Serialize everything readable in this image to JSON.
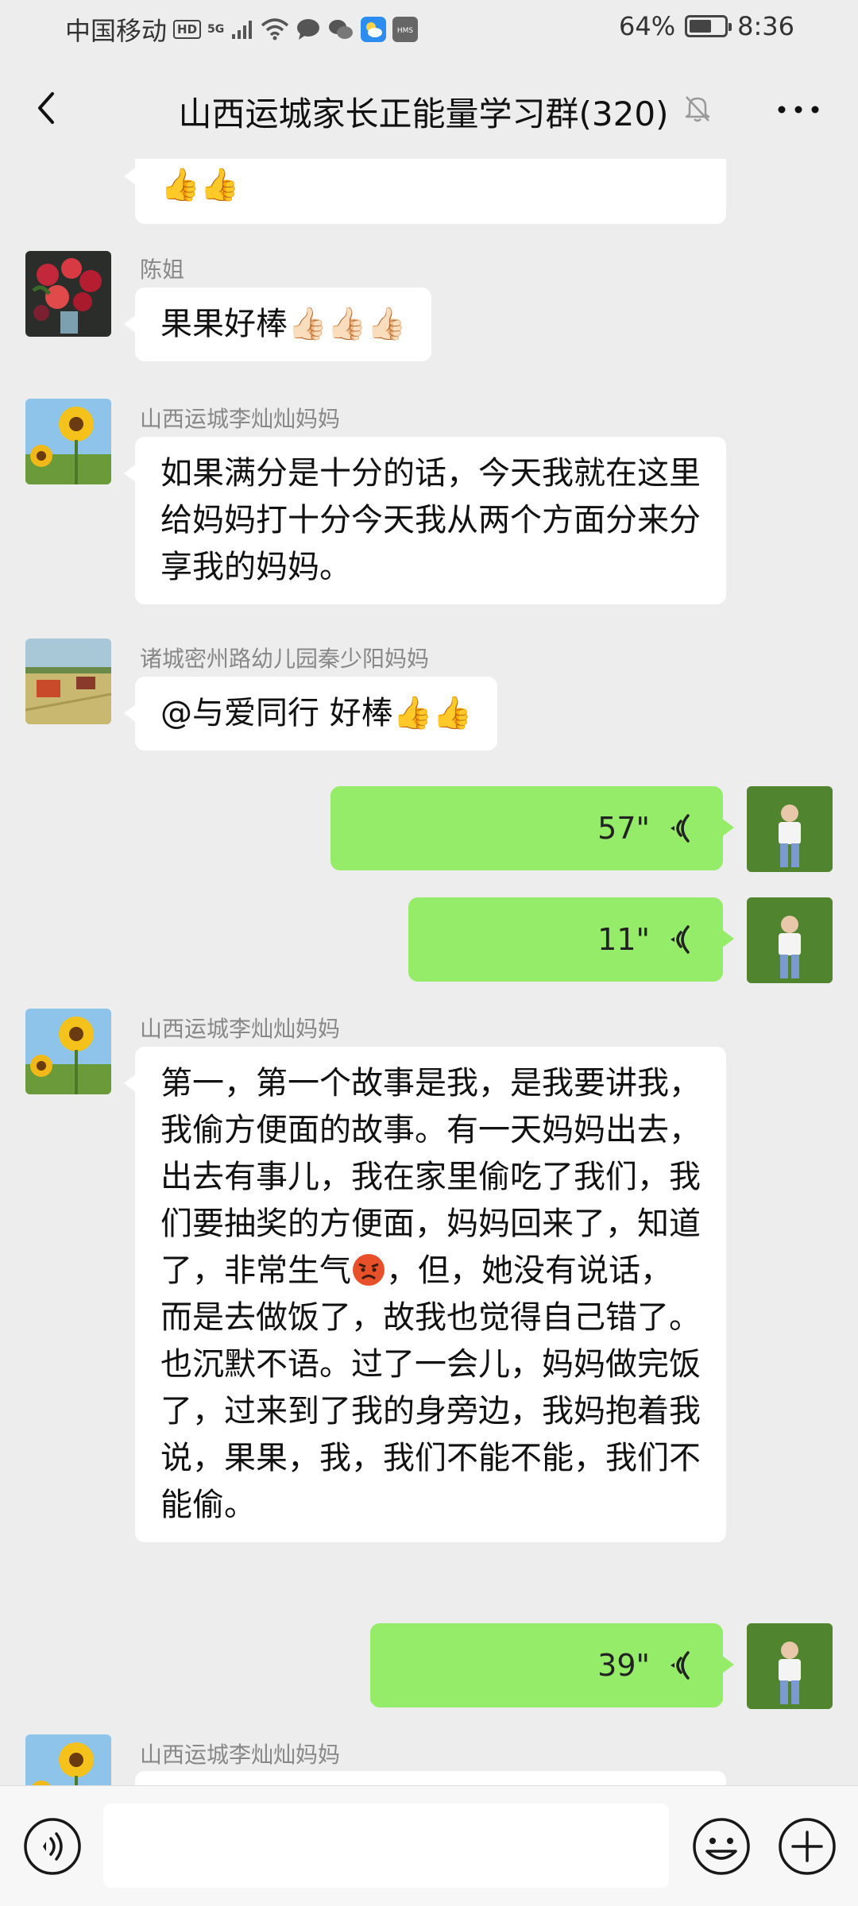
{
  "status_bar": {
    "carrier": "中国移动",
    "hd": "HD",
    "network": "5G",
    "battery": "64%",
    "battery_level": 0.64,
    "time": "8:36"
  },
  "header": {
    "title": "山西运城家长正能量学习群(320)",
    "back_icon": "chevron-left-icon",
    "mute_icon": "bell-off-icon",
    "more_icon": "more-dots-icon"
  },
  "messages": [
    {
      "type": "text",
      "direction": "in",
      "text": "👍👍",
      "partial": true
    },
    {
      "type": "text",
      "direction": "in",
      "sender": "陈姐",
      "text": "果果好棒👍🏻👍🏻👍🏻"
    },
    {
      "type": "text",
      "direction": "in",
      "sender": "山西运城李灿灿妈妈",
      "text": "如果满分是十分的话，今天我就在这里给妈妈打十分今天我从两个方面分来分享我的妈妈。"
    },
    {
      "type": "text",
      "direction": "in",
      "sender": "诸城密州路幼儿园秦少阳妈妈",
      "text": "@与爱同行  好棒👍👍"
    },
    {
      "type": "voice",
      "direction": "out",
      "duration": "57\""
    },
    {
      "type": "voice",
      "direction": "out",
      "duration": "11\""
    },
    {
      "type": "text",
      "direction": "in",
      "sender": "山西运城李灿灿妈妈",
      "text_before_emoji": "第一，第一个故事是我，是我要讲我，我偷方便面的故事。有一天妈妈出去，出去有事儿，我在家里偷吃了我们，我们要抽奖的方便面，妈妈回来了，知道了，非常生气",
      "text_after_emoji": "，但，她没有说话，而是去做饭了，故我也觉得自己错了。也沉默不语。过了一会儿，妈妈做完饭了，过来到了我的身旁边，我妈抱着我说，果果，我，我们不能不能，我们不能偷。",
      "emoji": "angry-face-icon"
    },
    {
      "type": "voice",
      "direction": "out",
      "duration": "39\""
    },
    {
      "type": "text",
      "direction": "in",
      "sender": "山西运城李灿灿妈妈",
      "text": "",
      "partial": true
    }
  ],
  "input_bar": {
    "voice_icon": "voice-input-icon",
    "placeholder": "",
    "emoji_icon": "emoji-icon",
    "plus_icon": "plus-icon"
  },
  "colors": {
    "background": "#ededed",
    "outgoing_bubble": "#95ec69",
    "incoming_bubble": "#ffffff",
    "sender_name": "#888888"
  }
}
